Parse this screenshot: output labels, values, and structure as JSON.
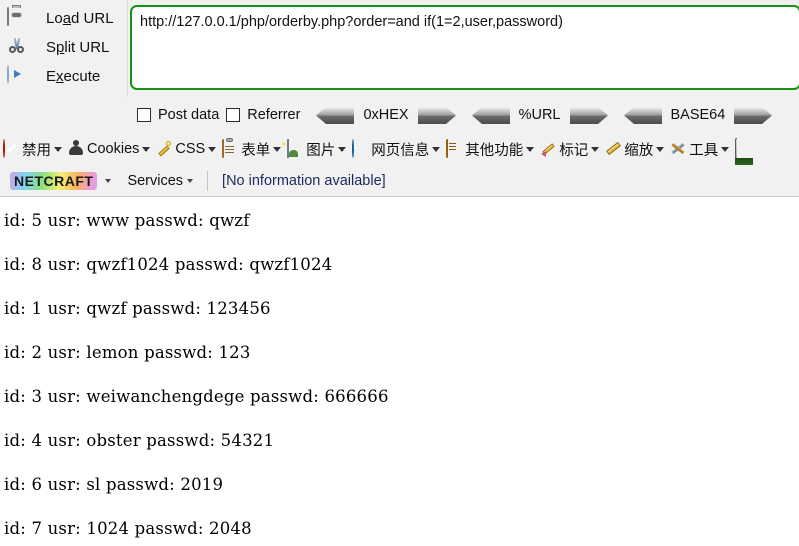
{
  "hackbar": {
    "actions": [
      {
        "icon": "load-url-icon",
        "label_pre": "Lo",
        "label_key": "a",
        "label_post": "d URL",
        "name": "load-url"
      },
      {
        "icon": "split-url-icon",
        "label_pre": "S",
        "label_key": "p",
        "label_post": "lit URL",
        "name": "split-url"
      },
      {
        "icon": "execute-icon",
        "label_pre": "E",
        "label_key": "x",
        "label_post": "ecute",
        "name": "execute"
      }
    ],
    "url_value": "http://127.0.0.1/php/orderby.php?order=and if(1=2,user,password)",
    "url_border_color": "#169016",
    "checkboxes": [
      {
        "label": "Post data",
        "checked": false
      },
      {
        "label": "Referrer",
        "checked": false
      }
    ],
    "encoders": [
      {
        "label": "0xHEX"
      },
      {
        "label": "%URL"
      },
      {
        "label": "BASE64"
      }
    ]
  },
  "webdev_toolbar": {
    "items": [
      {
        "label": "禁用",
        "icon": "disable-icon",
        "has_caret": true
      },
      {
        "label": "Cookies",
        "icon": "cookie-icon",
        "has_caret": true
      },
      {
        "label": "CSS",
        "icon": "css-pen-icon",
        "has_caret": true
      },
      {
        "label": "表单",
        "icon": "form-clipboard-icon",
        "has_caret": true
      },
      {
        "label": "图片",
        "icon": "image-icon",
        "has_caret": true
      },
      {
        "label": "网页信息",
        "icon": "info-icon",
        "has_caret": true
      },
      {
        "label": "其他功能",
        "icon": "misc-book-icon",
        "has_caret": true
      },
      {
        "label": "标记",
        "icon": "pencil-icon",
        "has_caret": true
      },
      {
        "label": "缩放",
        "icon": "ruler-icon",
        "has_caret": true
      },
      {
        "label": "工具",
        "icon": "tools-icon",
        "has_caret": true
      },
      {
        "label": "",
        "icon": "view-source-screen-icon",
        "has_caret": false
      }
    ]
  },
  "netcraft_toolbar": {
    "logo_text": "NETCRAFT",
    "services_label": "Services",
    "status_text": "[No information available]",
    "status_color": "#1a2a5e"
  },
  "page_content": {
    "lines": [
      "id: 5 usr: www passwd: qwzf",
      "id: 8 usr: qwzf1024 passwd: qwzf1024",
      "id: 1 usr: qwzf passwd: 123456",
      "id: 2 usr: lemon passwd: 123",
      "id: 3 usr: weiwanchengdege passwd: 666666",
      "id: 4 usr: obster passwd: 54321",
      "id: 6 usr: sl passwd: 2019",
      "id: 7 usr: 1024 passwd: 2048"
    ],
    "records": [
      {
        "id": "5",
        "usr": "www",
        "passwd": "qwzf"
      },
      {
        "id": "8",
        "usr": "qwzf1024",
        "passwd": "qwzf1024"
      },
      {
        "id": "1",
        "usr": "qwzf",
        "passwd": "123456"
      },
      {
        "id": "2",
        "usr": "lemon",
        "passwd": "123"
      },
      {
        "id": "3",
        "usr": "weiwanchengdege",
        "passwd": "666666"
      },
      {
        "id": "4",
        "usr": "obster",
        "passwd": "54321"
      },
      {
        "id": "6",
        "usr": "sl",
        "passwd": "2019"
      },
      {
        "id": "7",
        "usr": "1024",
        "passwd": "2048"
      }
    ]
  }
}
